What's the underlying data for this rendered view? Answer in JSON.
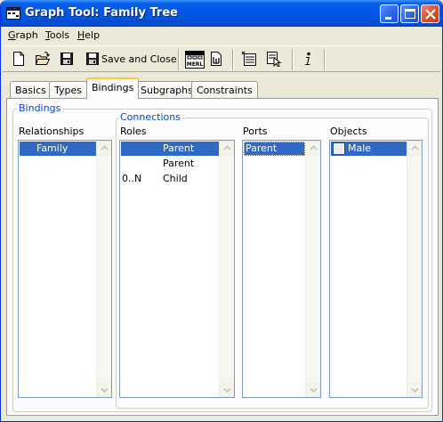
{
  "window": {
    "title": "Graph Tool: Family Tree"
  },
  "menu": [
    {
      "label": "Graph",
      "accel": "G",
      "rest": "raph"
    },
    {
      "label": "Tools",
      "accel": "T",
      "rest": "ools"
    },
    {
      "label": "Help",
      "accel": "H",
      "rest": "elp"
    }
  ],
  "toolbar": {
    "save_close_label": "Save and Close",
    "icons": [
      "new-icon",
      "open-icon",
      "save-icon",
      "save-close-icon",
      "merl-icon",
      "report-icon",
      "properties-icon",
      "select-icon",
      "info-icon"
    ]
  },
  "tabs": [
    {
      "label": "Basics"
    },
    {
      "label": "Types"
    },
    {
      "label": "Bindings",
      "active": true
    },
    {
      "label": "Subgraphs"
    },
    {
      "label": "Constraints"
    }
  ],
  "bindings": {
    "group_label": "Bindings",
    "connections_label": "Connections",
    "relationships": {
      "header": "Relationships",
      "items": [
        {
          "label": "Family",
          "selected": true
        }
      ]
    },
    "roles": {
      "header": "Roles",
      "items": [
        {
          "cardinality": "",
          "name": "Parent",
          "selected": true
        },
        {
          "cardinality": "",
          "name": "Parent",
          "selected": false
        },
        {
          "cardinality": "0..N",
          "name": "Child",
          "selected": false
        }
      ]
    },
    "ports": {
      "header": "Ports",
      "items": [
        {
          "label": "Parent",
          "selected": true
        }
      ]
    },
    "objects": {
      "header": "Objects",
      "items": [
        {
          "label": "Male",
          "selected": true,
          "checked": false
        }
      ]
    }
  },
  "colors": {
    "selection": "#316ac5",
    "group_label": "#0046d5",
    "active_tab_accent": "#ffc83c",
    "titlebar": "#0058e6"
  }
}
